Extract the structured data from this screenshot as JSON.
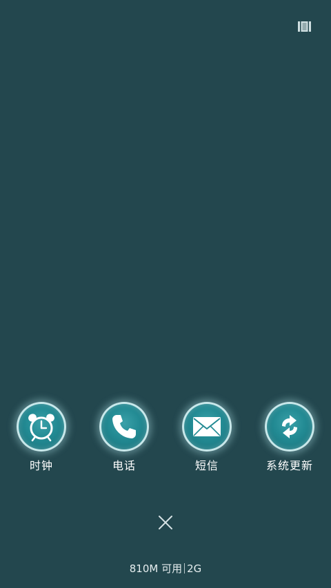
{
  "top_icon": "view-switch-icon",
  "apps": [
    {
      "label": "时钟",
      "icon": "alarm-clock-icon"
    },
    {
      "label": "电话",
      "icon": "phone-icon"
    },
    {
      "label": "短信",
      "icon": "envelope-icon"
    },
    {
      "label": "系统更新",
      "icon": "refresh-icon"
    }
  ],
  "close_icon": "close-icon",
  "status": {
    "memory": "810M 可用",
    "network": "2G"
  },
  "colors": {
    "background": "#23474e",
    "icon_circle": "#228a93",
    "icon_ring": "#e6fafc"
  }
}
